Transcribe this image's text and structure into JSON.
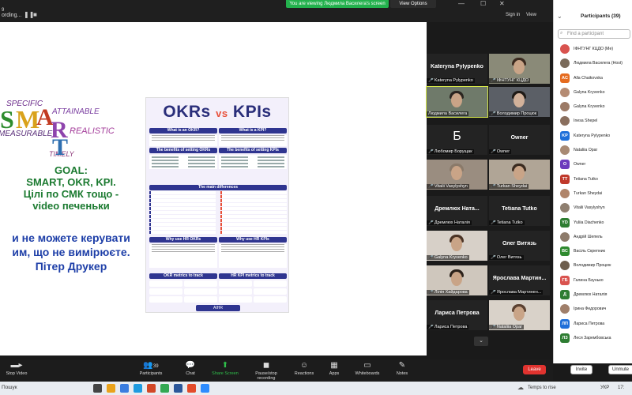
{
  "topbar": {
    "window_label": "9",
    "recording": "ording...",
    "viewing_banner": "You are viewing Людмила Василега's screen",
    "view_options": "View Options",
    "sign_in": "Sign in",
    "view": "View"
  },
  "slide": {
    "smart": {
      "specific": "SPECIFIC",
      "attainable": "ATTAINABLE",
      "measurable": "MEASURABLE",
      "realistic": "REALISTIC",
      "timely": "TIMELY",
      "letters": [
        "S",
        "M",
        "A",
        "R",
        "T"
      ]
    },
    "goal_lines": [
      "GOAL:",
      "SMART, OKR, KPI.",
      "Цілі по СМК тощо  -",
      "video печеньки"
    ],
    "quote_lines": [
      "и не можете керувати",
      "им, що не вимірюєте.",
      "Пітер Друкер"
    ],
    "infographic": {
      "title_left": "OKRs",
      "title_vs": "vs",
      "title_right": "KPIs",
      "what_okr": "What is an OKR?",
      "what_kpi": "What is a KPI?",
      "benefits_okr": "The benefits of setting OKRs",
      "benefits_kpi": "The benefits of setting KPIs",
      "main_differences": "The main differences",
      "why_okr": "Why use HR OKRs",
      "why_kpi": "Why use HR KPIs",
      "okr_metrics": "OKR metrics to track",
      "kpi_metrics": "HR KPI metrics to track",
      "brand": "AIHR"
    }
  },
  "tiles": [
    {
      "center": "Kateryna  Pylypenko",
      "label": "Kateryna Pylypenko",
      "video": false
    },
    {
      "center": "",
      "label": "ІФНТУНГ КЦДО",
      "video": true
    },
    {
      "center": "",
      "label": "Людмила Василега",
      "video": true,
      "highlight": true
    },
    {
      "center": "",
      "label": "Володимир Процюк",
      "video": true
    },
    {
      "center": "Б",
      "label": "Любомир Борущак",
      "video": false
    },
    {
      "center": "Owner",
      "label": "Owner",
      "video": false
    },
    {
      "center": "",
      "label": "Vitalii Vasylyshyn",
      "video": true
    },
    {
      "center": "",
      "label": "Turkan Sheydai",
      "video": true
    },
    {
      "center": "Дремлюх  Ната...",
      "label": "Дремлюх Наталія",
      "video": false
    },
    {
      "center": "Tetiana Tutko",
      "label": "Tetiana Tutko",
      "video": false
    },
    {
      "center": "",
      "label": "Galyna Kryvenko",
      "video": true
    },
    {
      "center": "Олег Витязь",
      "label": "Олег Витязь",
      "video": false
    },
    {
      "center": "",
      "label": "Лілія Хайдарова",
      "video": true
    },
    {
      "center": "Ярослава  Мартин...",
      "label": "Ярослава Мартинен...",
      "video": false
    },
    {
      "center": "Лариса Петрова",
      "label": "Лариса Петрова",
      "video": false
    },
    {
      "center": "",
      "label": "Nataliia Opar",
      "video": true
    }
  ],
  "participants": {
    "title": "Participants (39)",
    "search_placeholder": "Find a participant",
    "list": [
      {
        "name": "ІФНТУНГ КЦДО (Me)",
        "avatar": "",
        "color": "#d9534f"
      },
      {
        "name": "Людмила Василега (Host)",
        "avatar": "",
        "color": "#7a6a5a"
      },
      {
        "name": "Alla Chaikovska",
        "avatar": "AC",
        "color": "#e56b1f"
      },
      {
        "name": "Galyna Kryvenko",
        "avatar": "",
        "color": "#b58b73"
      },
      {
        "name": "Galyna Kryvenko",
        "avatar": "",
        "color": "#9c7a66"
      },
      {
        "name": "Inesa Shepel",
        "avatar": "",
        "color": "#8a6f5e"
      },
      {
        "name": "Kateryna Pylypenko",
        "avatar": "KP",
        "color": "#1e6fd9"
      },
      {
        "name": "Nataliia Opar",
        "avatar": "",
        "color": "#a88a74"
      },
      {
        "name": "Owner",
        "avatar": "O",
        "color": "#6c3bbd"
      },
      {
        "name": "Tetiana Tutko",
        "avatar": "TT",
        "color": "#c0392b"
      },
      {
        "name": "Turkan Sheydai",
        "avatar": "",
        "color": "#b0856a"
      },
      {
        "name": "Vitalii Vasylyshyn",
        "avatar": "",
        "color": "#8f7f70"
      },
      {
        "name": "Yuliia Diachenko",
        "avatar": "YD",
        "color": "#2e7d32"
      },
      {
        "name": "Андрій Шепель",
        "avatar": "",
        "color": "#8d7b6b"
      },
      {
        "name": "Васіль Скрепник",
        "avatar": "ВС",
        "color": "#2f8a2f"
      },
      {
        "name": "Володимир Процюк",
        "avatar": "",
        "color": "#6d5d4d"
      },
      {
        "name": "Галина Бзунько",
        "avatar": "ГБ",
        "color": "#d9534f"
      },
      {
        "name": "Дремлюх Наталія",
        "avatar": "Д",
        "color": "#2e7d32"
      },
      {
        "name": "Ірина Федорович",
        "avatar": "",
        "color": "#a07f6a"
      },
      {
        "name": "Лариса Петрова",
        "avatar": "ЛП",
        "color": "#1e6fd9"
      },
      {
        "name": "Леся Зарембовська",
        "avatar": "ЛЗ",
        "color": "#2e7d32"
      }
    ],
    "invite": "Invite",
    "unmute": "Unmute"
  },
  "toolbar": {
    "stop_video": "Stop Video",
    "participants": "Participants",
    "participants_count": "39",
    "chat": "Chat",
    "share_screen": "Share Screen",
    "pause_recording": "Pause/stop recording",
    "reactions": "Reactions",
    "apps": "Apps",
    "whiteboards": "Whiteboards",
    "notes": "Notes",
    "leave": "Leave"
  },
  "taskbar": {
    "search": "Пошук",
    "weather": "Temps to rise",
    "lang": "УКР",
    "clock": "17:"
  }
}
